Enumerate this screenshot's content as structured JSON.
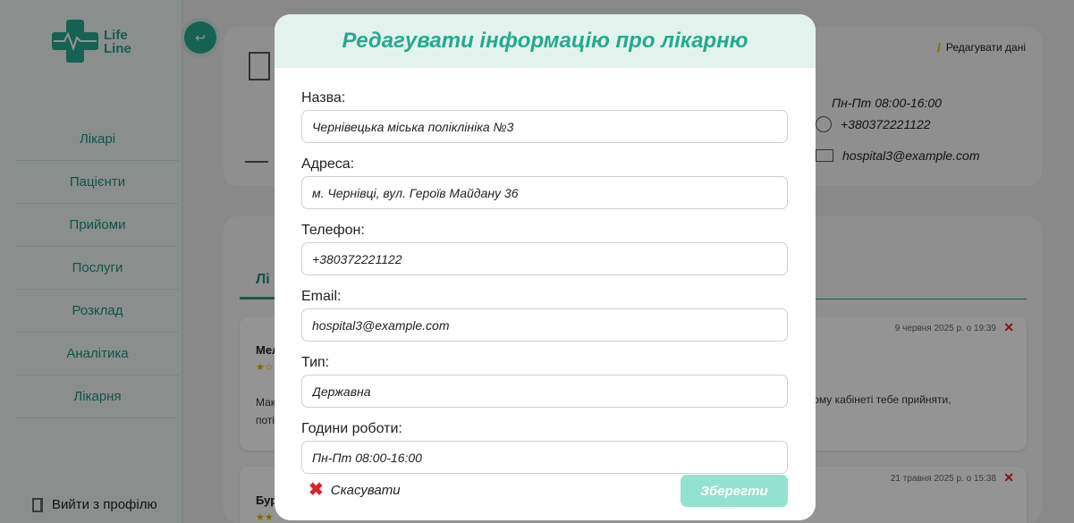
{
  "app": {
    "logo_line1": "Life",
    "logo_line2": "Line",
    "nav": [
      "Лікарі",
      "Пацієнти",
      "Прийоми",
      "Послуги",
      "Розклад",
      "Аналітика",
      "Лікарня"
    ],
    "logout_label": "Вийти з профілю",
    "collapse_icon": "arrow-return-icon"
  },
  "hospital_card": {
    "edit_label": "Редагувати дані",
    "hours": "Пн-Пт 08:00-16:00",
    "phone": "+380372221122",
    "email": "hospital3@example.com"
  },
  "reviews": {
    "tab_label": "Лі",
    "items": [
      {
        "name": "Мел",
        "date": "9 червня 2025 р. о 19:39",
        "stars": "★☆",
        "text_left_1": "Мак",
        "text_left_2": "поті",
        "text_right": "ь в якому кабінеті тебе прийняти,"
      },
      {
        "name": "Бур",
        "date": "21 травня 2025 р. о 15:38",
        "stars": "★★",
        "text_left_1": "",
        "text_left_2": "",
        "text_right": ""
      }
    ]
  },
  "modal": {
    "title": "Редагувати інформацію про лікарню",
    "fields": [
      {
        "label": "Назва:",
        "value": "Чернівецька міська поліклініка №3"
      },
      {
        "label": "Адреса:",
        "value": "м. Чернівці, вул. Героїв Майдану 36"
      },
      {
        "label": "Телефон:",
        "value": "+380372221122"
      },
      {
        "label": "Email:",
        "value": "hospital3@example.com"
      },
      {
        "label": "Тип:",
        "value": "Державна"
      },
      {
        "label": "Години роботи:",
        "value": "Пн-Пт 08:00-16:00"
      }
    ],
    "cancel_label": "Скасувати",
    "save_label": "Зберегти"
  },
  "colors": {
    "accent": "#26a98e",
    "save_disabled": "#93e2cf",
    "cancel_icon": "#d9262b"
  }
}
